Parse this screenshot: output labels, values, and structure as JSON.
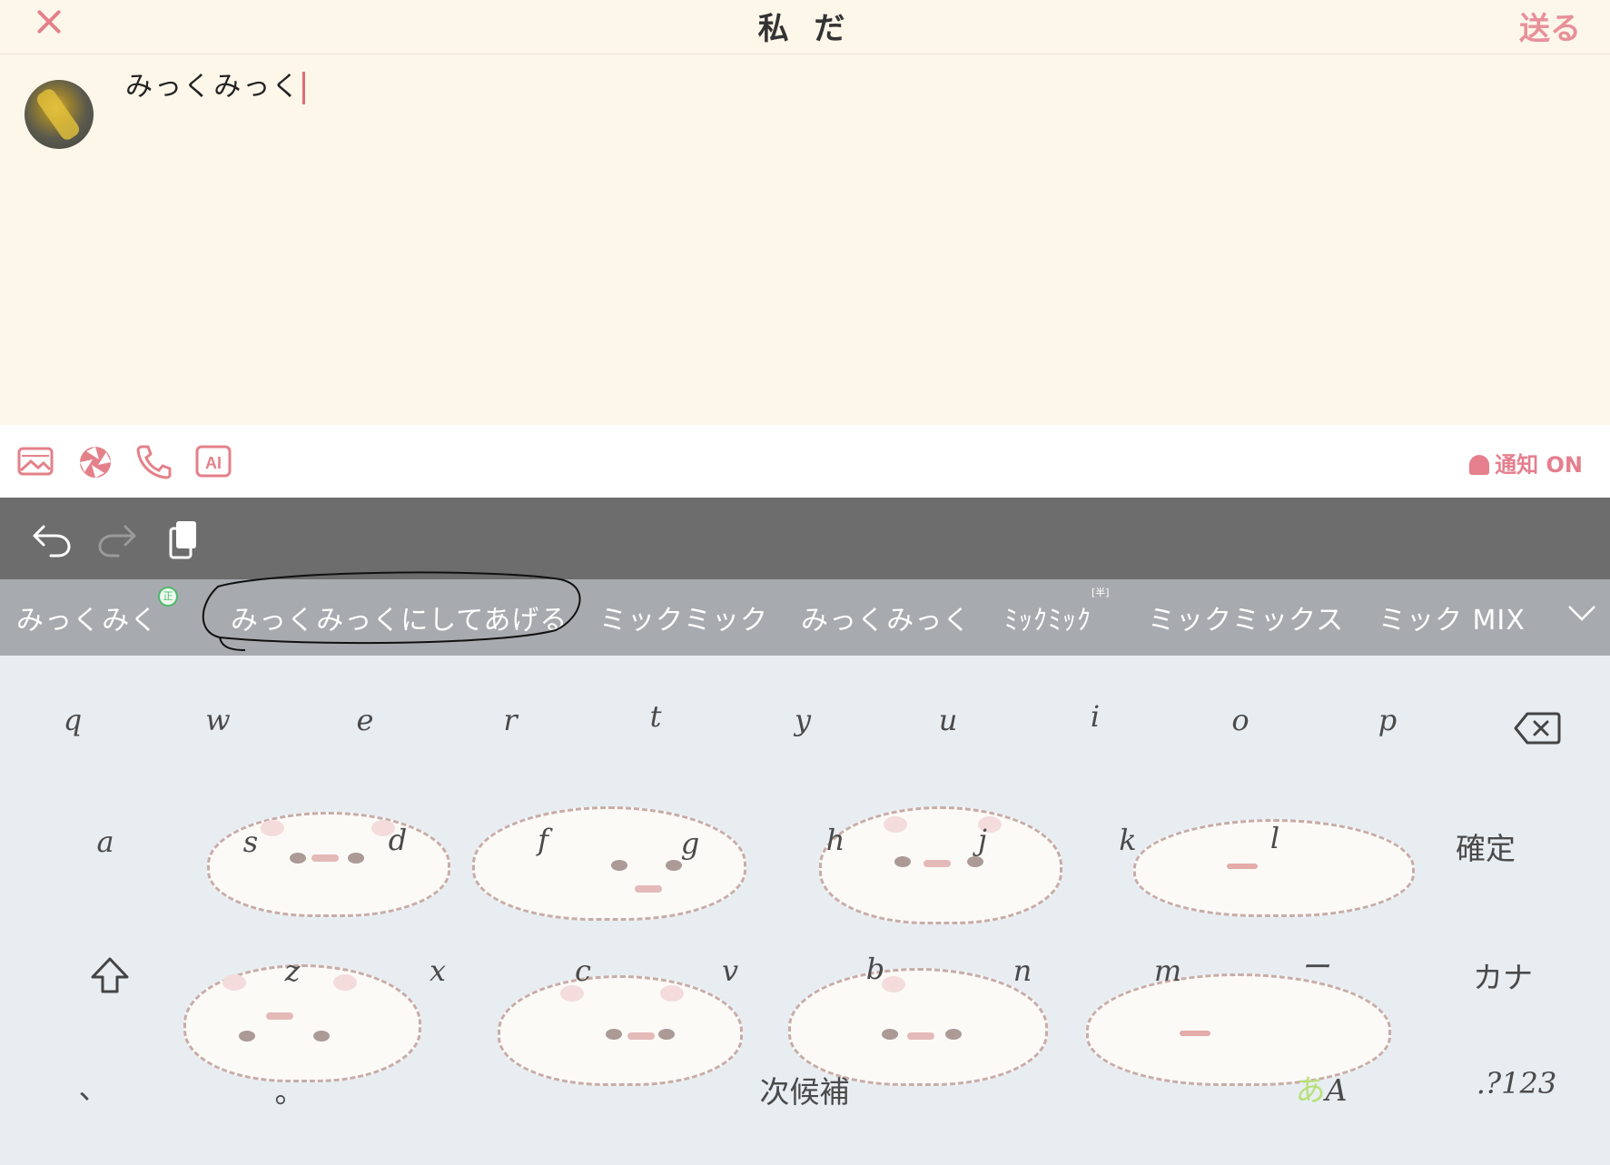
{
  "header": {
    "title": "私 だ",
    "send_label": "送る"
  },
  "compose": {
    "text": "みっくみっく"
  },
  "toolbar": {
    "notify_label": "通知 ON",
    "ai_label": "AI"
  },
  "candidates": {
    "items": [
      "みっくみく",
      "みっくみっくにしてあげる",
      "ミックミック",
      "みっくみっく",
      "ﾐｯｸﾐｯｸ",
      "ミックミックス",
      "ミック MIX"
    ],
    "badge_seisho": "正",
    "badge_han": "[半]"
  },
  "keyboard": {
    "row1": [
      "q",
      "w",
      "e",
      "r",
      "t",
      "y",
      "u",
      "i",
      "o",
      "p"
    ],
    "row2": [
      "a",
      "s",
      "d",
      "f",
      "g",
      "h",
      "j",
      "k",
      "l"
    ],
    "confirm_label": "確定",
    "row3": [
      "z",
      "x",
      "c",
      "v",
      "b",
      "n",
      "m",
      "ー"
    ],
    "kana_label": "カナ",
    "row4_comma": "、",
    "row4_period": "。",
    "next_candidate_label": "次候補",
    "mode_label_a": "あ",
    "mode_label_b": "A",
    "numbers_label": ".?123"
  },
  "colors": {
    "accent": "#e4808a",
    "header_bg": "#fdf7ea",
    "editbar_bg": "#6d6d6d",
    "candbar_bg": "#a7aaae",
    "keyboard_bg": "#e8edf2"
  }
}
